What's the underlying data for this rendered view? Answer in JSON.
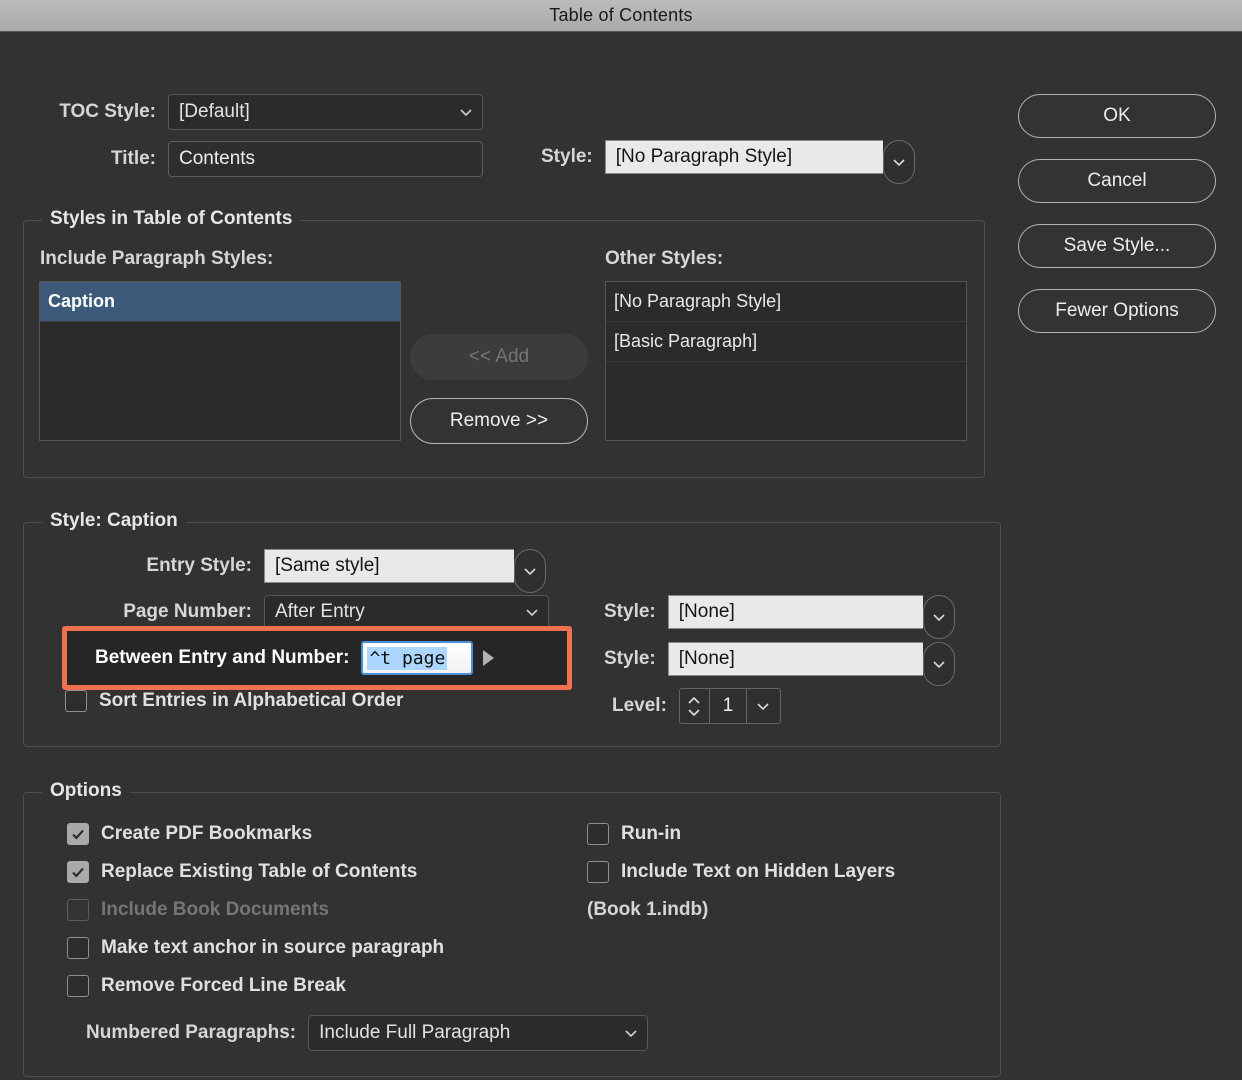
{
  "window": {
    "title": "Table of Contents"
  },
  "top": {
    "toc_style_label": "TOC Style:",
    "toc_style_value": "[Default]",
    "title_label": "Title:",
    "title_value": "Contents",
    "title_style_label": "Style:",
    "title_style_value": "[No Paragraph Style]"
  },
  "buttons": {
    "ok": "OK",
    "cancel": "Cancel",
    "save_style": "Save Style...",
    "fewer_options": "Fewer Options"
  },
  "styles_group": {
    "legend": "Styles in Table of Contents",
    "include_label": "Include Paragraph Styles:",
    "other_label": "Other Styles:",
    "include_items": [
      "Caption"
    ],
    "other_items": [
      "[No Paragraph Style]",
      "[Basic Paragraph]"
    ],
    "add_button": "<< Add",
    "remove_button": "Remove >>"
  },
  "caption_group": {
    "legend": "Style: Caption",
    "entry_style_label": "Entry Style:",
    "entry_style_value": "[Same style]",
    "page_number_label": "Page Number:",
    "page_number_value": "After Entry",
    "page_number_style_label": "Style:",
    "page_number_style_value": "[None]",
    "between_label": "Between Entry and Number:",
    "between_value": "^t page",
    "between_style_label": "Style:",
    "between_style_value": "[None]",
    "sort_label": "Sort Entries in Alphabetical Order",
    "sort_checked": false,
    "level_label": "Level:",
    "level_value": "1"
  },
  "options_group": {
    "legend": "Options",
    "left_items": [
      {
        "label": "Create PDF Bookmarks",
        "checked": true,
        "disabled": false
      },
      {
        "label": "Replace Existing Table of Contents",
        "checked": true,
        "disabled": false
      },
      {
        "label": "Include Book Documents",
        "checked": false,
        "disabled": true
      },
      {
        "label": "Make text anchor in source paragraph",
        "checked": false,
        "disabled": false
      },
      {
        "label": "Remove Forced Line Break",
        "checked": false,
        "disabled": false
      }
    ],
    "right_items": [
      {
        "label": "Run-in",
        "checked": false,
        "disabled": false
      },
      {
        "label": "Include Text on Hidden Layers",
        "checked": false,
        "disabled": false
      }
    ],
    "book_file": "(Book 1.indb)",
    "numbered_label": "Numbered Paragraphs:",
    "numbered_value": "Include Full Paragraph"
  },
  "colors": {
    "accent_highlight": "#f0714f",
    "selection_blue": "#3d5a7a",
    "dialog_bg": "#323232",
    "titlebar_bg": "#b2b2b2",
    "field_selection": "#add6ff"
  }
}
